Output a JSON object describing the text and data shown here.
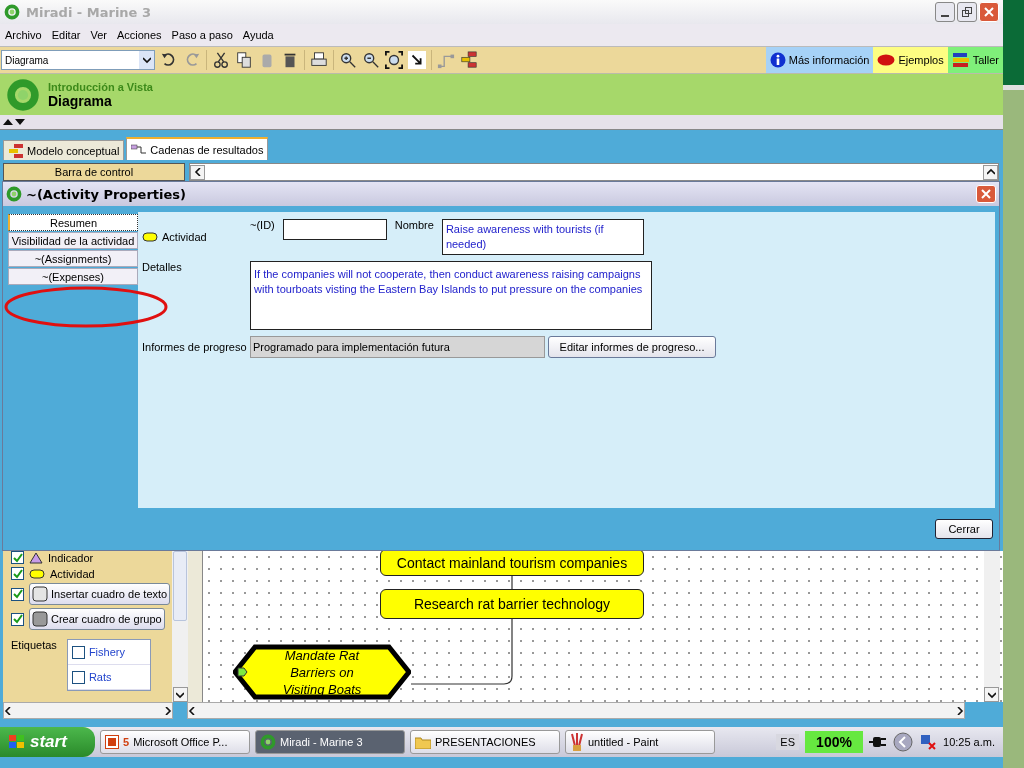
{
  "window": {
    "title": "Miradi - Marine 3"
  },
  "menu": [
    "Archivo",
    "Editar",
    "Ver",
    "Acciones",
    "Paso a paso",
    "Ayuda"
  ],
  "toolbar": {
    "view_select": "Diagrama",
    "help_buttons": [
      {
        "label": "Más información",
        "kind": "info"
      },
      {
        "label": "Ejemplos",
        "kind": "examples"
      },
      {
        "label": "Taller",
        "kind": "workshop"
      }
    ]
  },
  "header": {
    "subtitle": "Introducción a Vista",
    "title": "Diagrama"
  },
  "tabs": [
    {
      "label": "Modelo conceptual",
      "selected": false
    },
    {
      "label": "Cadenas de resultados",
      "selected": true
    }
  ],
  "control_bar": {
    "label": "Barra de control"
  },
  "dialog": {
    "title": "~(Activity Properties)",
    "nav": [
      {
        "label": "Resumen",
        "selected": true
      },
      {
        "label": "Visibilidad de la actividad",
        "selected": false
      },
      {
        "label": "~(Assignments)",
        "selected": false
      },
      {
        "label": "~(Expenses)",
        "selected": false
      }
    ],
    "type_label": "Actividad",
    "id_label": "~(ID)",
    "name_label": "Nombre",
    "name_value": "Raise awareness with tourists (if needed)",
    "details_label": "Detalles",
    "details_value": "If the companies will not cooperate, then conduct awareness raising campaigns with tourboats visting the Eastern Bay Islands to put pressure on the companies",
    "progress_label": "Informes de progreso",
    "progress_value": "Programado para implementación futura",
    "progress_button": "Editar informes de progreso...",
    "close_button": "Cerrar"
  },
  "legend": {
    "items": [
      {
        "label": "Indicador",
        "kind": "indicator",
        "checked": true
      },
      {
        "label": "Actividad",
        "kind": "activity",
        "checked": true
      },
      {
        "label": "Insertar cuadro de texto",
        "kind": "textbox",
        "checked": true
      },
      {
        "label": "Crear cuadro de grupo",
        "kind": "groupbox",
        "checked": true
      }
    ],
    "tags_label": "Etiquetas",
    "tags": [
      {
        "label": "Fishery",
        "checked": false
      },
      {
        "label": "Rats",
        "checked": false
      }
    ]
  },
  "diagram": {
    "nodes": [
      {
        "kind": "activity",
        "label": "Contact mainland tourism companies"
      },
      {
        "kind": "activity",
        "label": "Research rat barrier technology"
      },
      {
        "kind": "strategy",
        "label": "Mandate Rat Barriers on Visiting Boats"
      }
    ]
  },
  "taskbar": {
    "start": "start",
    "tasks": [
      {
        "label": "Microsoft Office P...",
        "count": "5",
        "kind": "powerpoint",
        "selected": false
      },
      {
        "label": "Miradi - Marine 3",
        "kind": "miradi",
        "selected": true
      },
      {
        "label": "PRESENTACIONES",
        "kind": "folder",
        "selected": false
      },
      {
        "label": "untitled - Paint",
        "kind": "paint",
        "selected": false
      }
    ],
    "language": "ES",
    "battery": "100%",
    "clock": "10:25 a.m."
  }
}
